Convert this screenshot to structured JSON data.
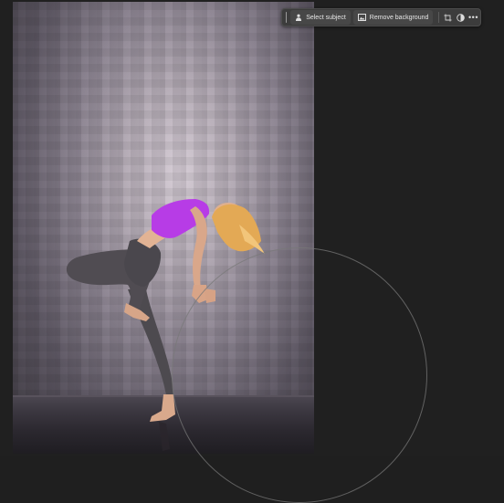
{
  "taskbar": {
    "select_subject_label": "Select subject",
    "remove_background_label": "Remove background",
    "select_subject_icon": "person-select-icon",
    "remove_background_icon": "image-icon",
    "crop_icon": "crop-icon",
    "adjustment_icon": "half-circle-adjustment-icon",
    "more_icon": "more-options-icon",
    "more_label": "•••"
  },
  "colors": {
    "canvas_background": "#202020",
    "taskbar_background": "#3c3c3c",
    "top_color": "#b73ce6"
  }
}
